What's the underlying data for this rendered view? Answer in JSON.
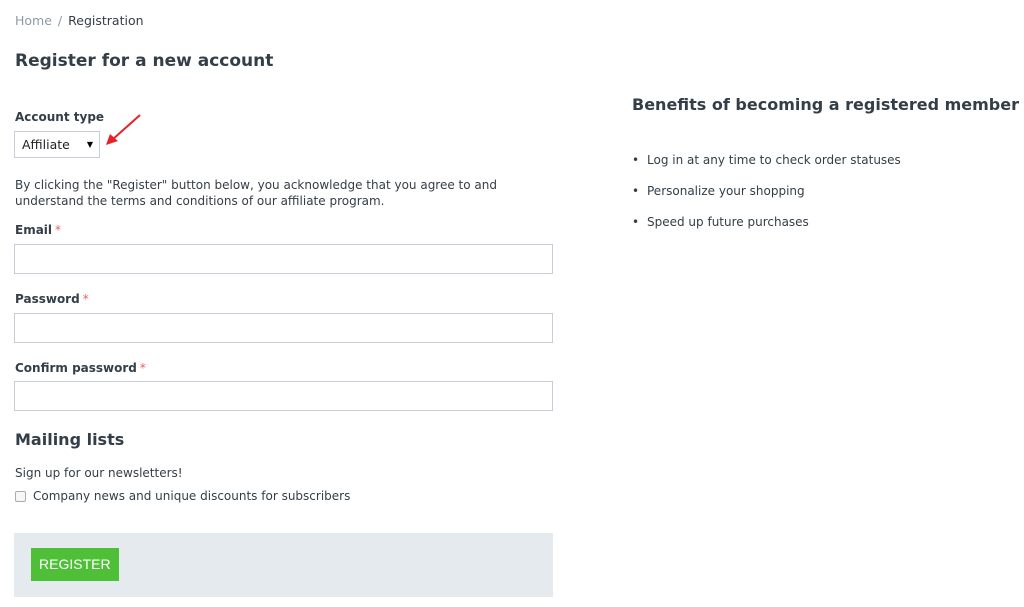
{
  "breadcrumb": {
    "home": "Home",
    "separator": "/",
    "current": "Registration"
  },
  "page_title": "Register for a new account",
  "account_type": {
    "label": "Account type",
    "selected": "Affiliate",
    "caret": "▼"
  },
  "description": "By clicking the \"Register\" button below, you acknowledge that you agree to and understand the terms and conditions of our affiliate program.",
  "fields": {
    "email": {
      "label": "Email",
      "required_mark": "*",
      "value": ""
    },
    "password": {
      "label": "Password",
      "required_mark": "*",
      "value": ""
    },
    "confirm_password": {
      "label": "Confirm password",
      "required_mark": "*",
      "value": ""
    }
  },
  "mailing": {
    "title": "Mailing lists",
    "subtitle": "Sign up for our newsletters!",
    "checkbox_label": "Company news and unique discounts for subscribers",
    "checked": false
  },
  "register_button": "REGISTER",
  "benefits": {
    "title": "Benefits of becoming a registered member",
    "bullet": "•",
    "items": [
      "Log in at any time to check order statuses",
      "Personalize your shopping",
      "Speed up future purchases"
    ]
  },
  "colors": {
    "accent_green": "#4fbf37",
    "required_red": "#e75e5e",
    "annotation_arrow": "#e8202a"
  }
}
